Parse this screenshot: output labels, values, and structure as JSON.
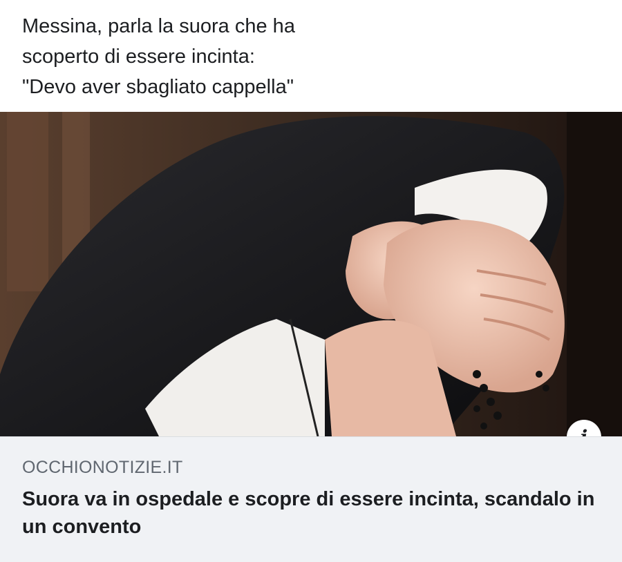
{
  "post": {
    "text_lines": [
      "Messina, parla la suora che ha",
      "scoperto di essere incinta:",
      "\"Devo aver sbagliato cappella\""
    ]
  },
  "link_card": {
    "image_icon": "info-icon",
    "info_glyph": "i",
    "domain": "OCCHIONOTIZIE.IT",
    "title": "Suora va in ospedale e scopre di essere incinta, scandalo in un convento"
  },
  "colors": {
    "footer_bg": "#f0f2f5",
    "domain_text": "#606770",
    "text": "#1c1e21"
  }
}
